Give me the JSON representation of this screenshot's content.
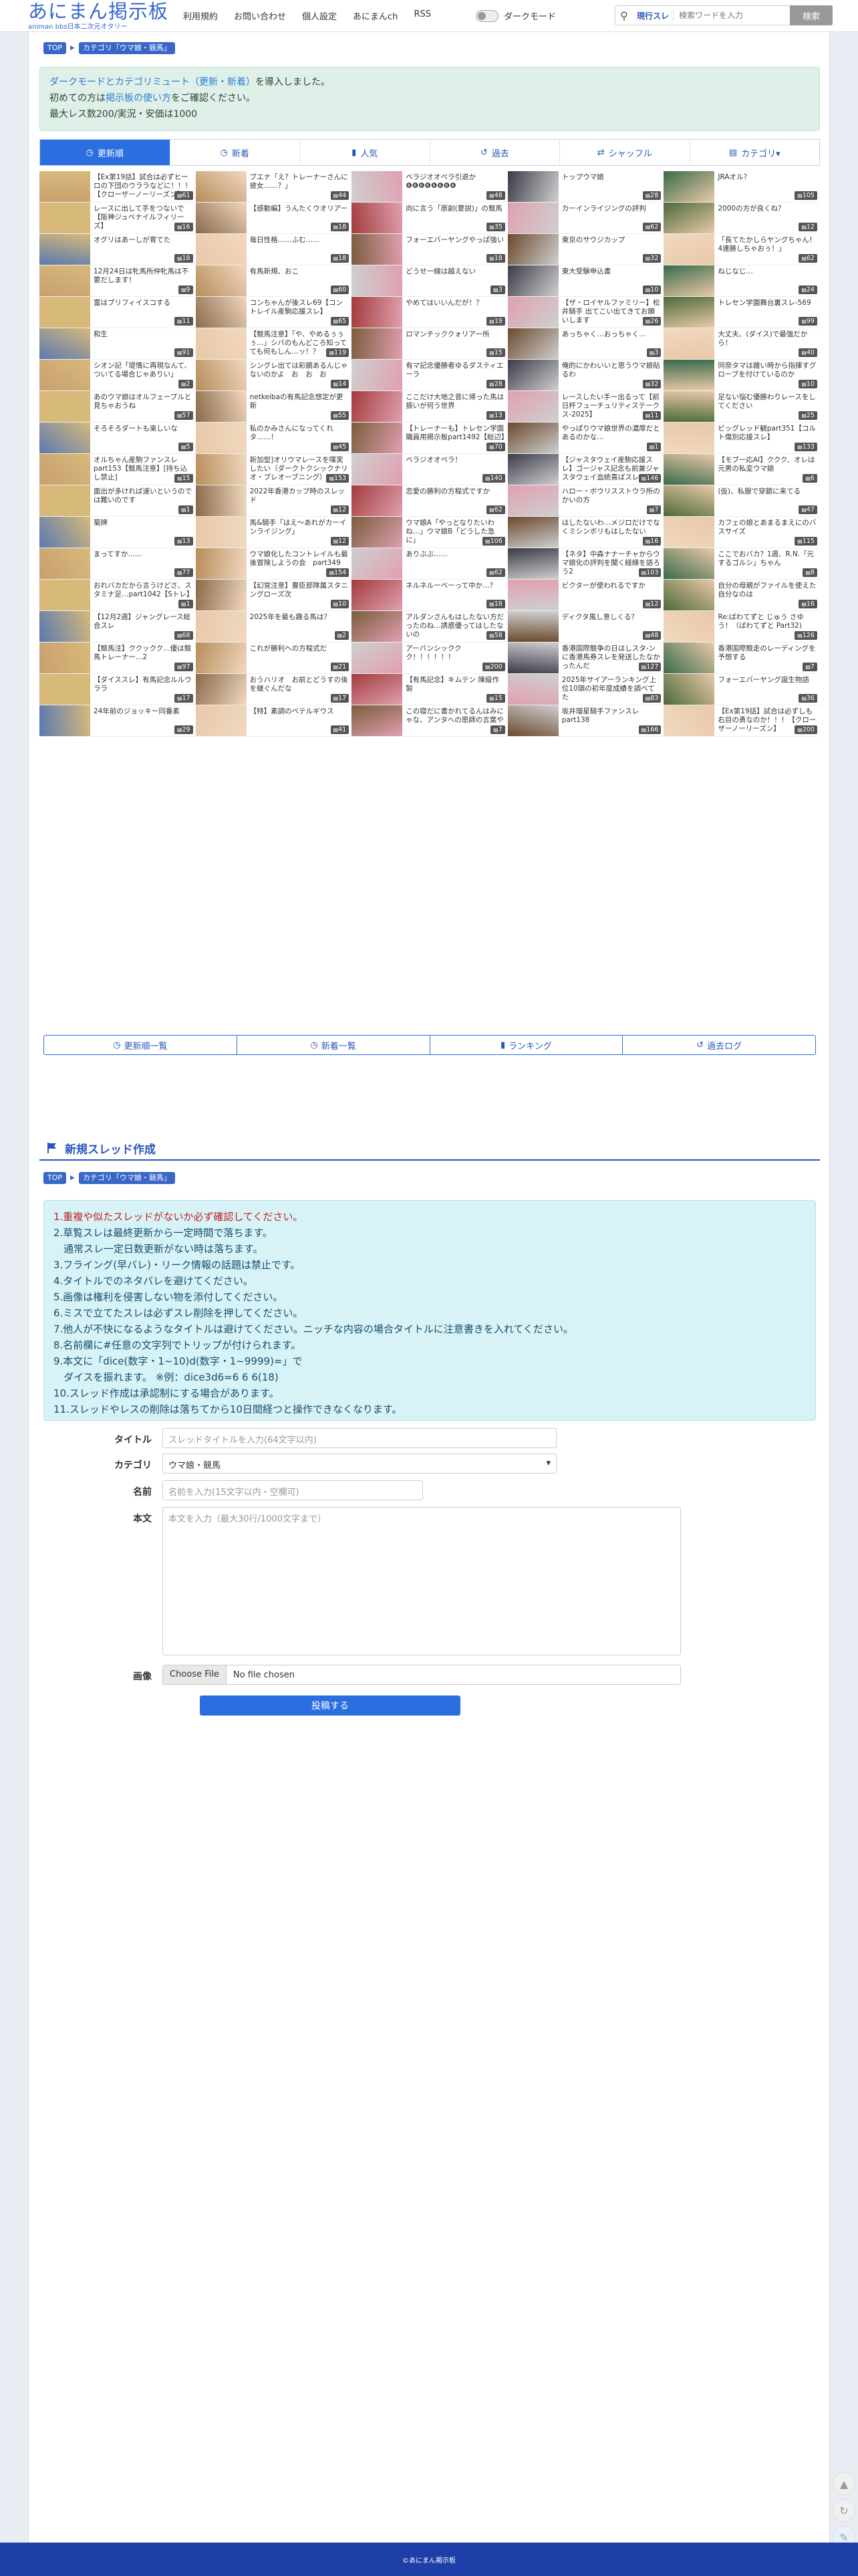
{
  "header": {
    "logo_main": "あにまん掲示板",
    "logo_sub": "animan bbs日本二次元オタリー",
    "nav": [
      "利用規約",
      "お問い合わせ",
      "個人設定",
      "あにまんch",
      "RSS"
    ],
    "dark_mode_label": "ダークモード",
    "search_scope": "現行スレ",
    "search_placeholder": "検索ワードを入力",
    "search_button": "検索"
  },
  "breadcrumb": [
    "TOP",
    "カテゴリ「ウマ娘・競馬」"
  ],
  "notice": {
    "line1_link": "ダークモードとカテゴリミュート（更新・新着）",
    "line1_rest": "を導入しました。",
    "line2_pre": "初めての方は",
    "line2_link": "掲示板の使い方",
    "line2_post": "をご確認ください。",
    "line3": "最大レス数200/実況・安価は1000"
  },
  "tabs": [
    {
      "label": "更新順",
      "icon": "clock-icon",
      "active": true
    },
    {
      "label": "新着",
      "icon": "clock-icon"
    },
    {
      "label": "人気",
      "icon": "bar-chart-icon"
    },
    {
      "label": "過去",
      "icon": "history-icon"
    },
    {
      "label": "シャッフル",
      "icon": "shuffle-icon"
    },
    {
      "label": "カテゴリ▾",
      "icon": "folder-icon"
    }
  ],
  "threads": [
    {
      "title": "【Ex第19話】試合は必ずヒーロの下団のウララなどに！！！【クローザーノーリーズン】",
      "count": "61"
    },
    {
      "title": "ブエナ「え？トレーナーさんに彼女……？」",
      "count": "44"
    },
    {
      "title": "ベラジオオペラ引退か❻❻❻❻❻❻❻❻",
      "count": "48"
    },
    {
      "title": "トップウマ娘",
      "count": "28"
    },
    {
      "title": "JRAオル？",
      "count": "105"
    },
    {
      "title": "レースに出して手をつないで【阪神ジュベナイルフィリーズ】",
      "count": "16"
    },
    {
      "title": "【感動編】うんたくウオリアー",
      "count": "18"
    },
    {
      "title": "向に言う「原創(要説)」の競馬",
      "count": "35"
    },
    {
      "title": "カーインライジングの評判",
      "count": "62"
    },
    {
      "title": "2000の方が良くね？",
      "count": "12"
    },
    {
      "title": "オグリはあーしが育てた",
      "count": "18"
    },
    {
      "title": "毎日性格……ふむ……",
      "count": "18"
    },
    {
      "title": "フォーエバーヤングやっぱ強い",
      "count": "18"
    },
    {
      "title": "東京のサウジカップ",
      "count": "32"
    },
    {
      "title": "「長てたかしらヤングちゃん！4連勝しちゃおぅ！」",
      "count": "62"
    },
    {
      "title": "12月24日は牝馬所仲牝馬は不要だします！",
      "count": "9"
    },
    {
      "title": "有馬新規、おこ",
      "count": "60"
    },
    {
      "title": "どうせ一線は越えない",
      "count": "3"
    },
    {
      "title": "東大受験申込書",
      "count": "10"
    },
    {
      "title": "ねじなじ…",
      "count": "24"
    },
    {
      "title": "富はブリフィイスコする",
      "count": "11"
    },
    {
      "title": "コンちゃんが後スレ69【コントレイル産駒応援スレ】",
      "count": "65"
    },
    {
      "title": "やめてはいいんだが！？",
      "count": "19"
    },
    {
      "title": "【ザ・ロイヤルファミリー】松井騎手 出てこい出てきてお願いします",
      "count": "26"
    },
    {
      "title": "トレセン学園舞台裏スレ-569",
      "count": "99"
    },
    {
      "title": "和生",
      "count": "91"
    },
    {
      "title": "【競馬注意】「や、やめるぅぅぅ…」シバのもんどころ知ってても何もしん…ッ！？",
      "count": "119"
    },
    {
      "title": "ロマンチッククォリア一所",
      "count": "15"
    },
    {
      "title": "あっちゃく…おっちゃく…",
      "count": "3"
    },
    {
      "title": "大丈夫、(ダイス)で最強だから！",
      "count": "40"
    },
    {
      "title": "シオン記「堤情に再現なんて、ついてる場合じゃありい」",
      "count": "2"
    },
    {
      "title": "シングレ出ては彩鏡あるんじゃないのかよ　お　お　お",
      "count": "14"
    },
    {
      "title": "有マ記念優勝者ゆるダスティエーラ",
      "count": "28"
    },
    {
      "title": "俺的にかわいいと思うウマ娘貼るわ",
      "count": "32"
    },
    {
      "title": "同奈タマは雑い時から指揮すグローブを付けているのか",
      "count": "10"
    },
    {
      "title": "あのウマ娘はオルフェーブルと見ちゃおうね",
      "count": "57"
    },
    {
      "title": "netkeibaの有馬記念想定が更新",
      "count": "55"
    },
    {
      "title": "ここだけ大地之音に帰った馬は振いが何う世界",
      "count": "13"
    },
    {
      "title": "レースしたい手ー出るって【前日杯フューチュリティステークス-2025】",
      "count": "11"
    },
    {
      "title": "足ない悩む優勝わりレースをしてください",
      "count": "25"
    },
    {
      "title": "そろそろダートも楽しいな",
      "count": "5"
    },
    {
      "title": "私のかみさんになってくれタ……！",
      "count": "45"
    },
    {
      "title": "【トレーナーも】トレセン学園職員用掲示板part1492【総辺】",
      "count": "70"
    },
    {
      "title": "やっぱりウマ娘世界の濃厚だとあるのかな…",
      "count": "1"
    },
    {
      "title": "ビッグレッド観part351【コルト傷別応援スレ】",
      "count": "133"
    },
    {
      "title": "オルちゃん産駒ファンスレpart153【競馬注意】[持ち込し禁止]",
      "count": "15"
    },
    {
      "title": "新加型]オリウマレースを喋実したい（ダークトクシックナリオ・ブレオーブニング）2",
      "count": "153"
    },
    {
      "title": "ベラジオオペラ！",
      "count": "140"
    },
    {
      "title": "【ジャスタウェイ産駒応援スレ】ゴージャス記念も前兼ジャスタウェイ血統喜ばスレ",
      "count": "146"
    },
    {
      "title": "【モブ一応AI】ククク、オレは元男の私変ウマ娘",
      "count": "6"
    },
    {
      "title": "面出が多ければ速いというのでは難いのです",
      "count": "1"
    },
    {
      "title": "2022年香港カップ時のスレッド",
      "count": "12"
    },
    {
      "title": "恋愛の勝利の方程式ですか",
      "count": "62"
    },
    {
      "title": "ハロー・ボウリスストウラ所のかいの方",
      "count": "7"
    },
    {
      "title": "(仮)、私服で穿鏡に来てる",
      "count": "47"
    },
    {
      "title": "菊牌",
      "count": "13"
    },
    {
      "title": "馬&騎手「はえ～あれがカーインライジング」",
      "count": "12"
    },
    {
      "title": "ウマ娘A「やっとなりたいわね…」ウマ娘B「どうした急に」",
      "count": "106"
    },
    {
      "title": "はしたないわ…メジロだけでなくミシンボリもはしたない",
      "count": "16"
    },
    {
      "title": "カフェの娘とあまるまえにのバスサイズ",
      "count": "115"
    },
    {
      "title": "まってすか……",
      "count": "77"
    },
    {
      "title": "ウマ娘化したコントレイルも最後冒険しようの会　part349",
      "count": "154"
    },
    {
      "title": "ありぶぶ……",
      "count": "62"
    },
    {
      "title": "【ネタ】中森ナナーチャからウマ娘化の評判を聞く経縁を語ろう2",
      "count": "103"
    },
    {
      "title": "ここでおバカ？1週、R.N.「元するゴルシ」ちゃん",
      "count": "8"
    },
    {
      "title": "おれバカだから言うけどさ、スタミナ足…part1042【Sトレ】",
      "count": "1"
    },
    {
      "title": "【幻覚注意】豊臣部隊属スタニングローズ次",
      "count": "10"
    },
    {
      "title": "ネルネルーベーって中か…？",
      "count": "18"
    },
    {
      "title": "ビクターが使われるですか",
      "count": "12"
    },
    {
      "title": "自分の母親がファイルを使えた自分なのは",
      "count": "16"
    },
    {
      "title": "【12月2週】ジャングレース総合スレ",
      "count": "68"
    },
    {
      "title": "2025年を最も趣る馬は？",
      "count": "2"
    },
    {
      "title": "アルダンさんもはしたない方だったのね…誘惑優ってはしたないの",
      "count": "58"
    },
    {
      "title": "ディクタ風し意しくる？",
      "count": "48"
    },
    {
      "title": "Re:ばわてずと じゅう さゆう！（ばわてずと Part32)",
      "count": "126"
    },
    {
      "title": "【競馬注】ククックク…優は競馬トレーナー…2",
      "count": "97"
    },
    {
      "title": "これが勝利への方程式だ",
      "count": "21"
    },
    {
      "title": "アーバンシッククク！！！！！！",
      "count": "200"
    },
    {
      "title": "香港国際競争の日はしスタ-ンに香港馬券スレを発送したなかったんだ",
      "count": "127"
    },
    {
      "title": "香港国際競走のレーディングを予想する",
      "count": "7"
    },
    {
      "title": "【ダイススレ】有馬記念ルルウララ",
      "count": "17"
    },
    {
      "title": "おうハリオ　お前とどうすの後を継ぐんだな",
      "count": "17"
    },
    {
      "title": "【有馬記念】キムテン 陳級作製",
      "count": "15"
    },
    {
      "title": "2025年サイアーランキング上位10頭の初年度成績を調べてた",
      "count": "83"
    },
    {
      "title": "フォーエバーヤング誕生物語",
      "count": "36"
    },
    {
      "title": "24年前のジョッキー同番素",
      "count": "29"
    },
    {
      "title": "【特】素調のベテルギウス",
      "count": "41"
    },
    {
      "title": "この寝だに書かれてるんはみにゃな、アンタへの思師の言葉や",
      "count": "7"
    },
    {
      "title": "坂井瑠星騎手ファンスレpart138",
      "count": "166"
    },
    {
      "title": "【Ex第19話】試合は必ずしも右目の勇なのか！！！【クローザーノーリーズン】",
      "count": "200"
    }
  ],
  "bottom_nav": [
    {
      "label": "更新順一覧",
      "icon": "clock-icon"
    },
    {
      "label": "新着一覧",
      "icon": "clock-icon"
    },
    {
      "label": "ランキング",
      "icon": "bar-chart-icon"
    },
    {
      "label": "過去ログ",
      "icon": "history-icon"
    }
  ],
  "new_thread": {
    "heading": "新規スレッド作成",
    "breadcrumb": [
      "TOP",
      "カテゴリ「ウマ娘・競馬」"
    ],
    "rules": [
      "1.重複や似たスレッドがないか必ず確認してください。",
      "2.草覧スレは最終更新から一定時間で落ちます。",
      "　通常スレ一定日数更新がない時は落ちます。",
      "3.フライング(早バレ)・リーク情報の話題は禁止です。",
      "4.タイトルでのネタバレを避けてください。",
      "5.画像は権利を侵害しない物を添付してください。",
      "6.ミスで立てたスレは必ずスレ削除を押してください。",
      "7.他人が不快になるようなタイトルは避けてください。ニッチな内容の場合タイトルに注意書きを入れてください。",
      "8.名前欄に#任意の文字列でトリップが付けられます。",
      "9.本文に「dice(数字・1~10)d(数字・1~9999)=」で",
      "　ダイスを振れます。 ※例：dice3d6=6 6 6(18)",
      "10.スレッド作成は承認制にする場合があります。",
      "11.スレッドやレスの削除は落ちてから10日間経つと操作できなくなります。"
    ],
    "title_label": "タイトル",
    "title_placeholder": "スレッドタイトルを入力(64文字以内)",
    "category_label": "カテゴリ",
    "category_value": "ウマ娘・競馬",
    "name_label": "名前",
    "name_placeholder": "名前を入力(15文字以内・空欄可)",
    "body_label": "本文",
    "body_placeholder": "本文を入力（最大30行/1000文字まで）",
    "image_label": "画像",
    "file_button": "Choose File",
    "file_status": "No file chosen",
    "submit": "投稿する"
  },
  "footer": "©あにまん掲示板",
  "colors": {
    "accent": "#2a6ee0",
    "brand": "#3867c8",
    "footer": "#1e3ea8",
    "notice_bg": "#dff0e8",
    "rules_bg": "#d8f3f8"
  }
}
